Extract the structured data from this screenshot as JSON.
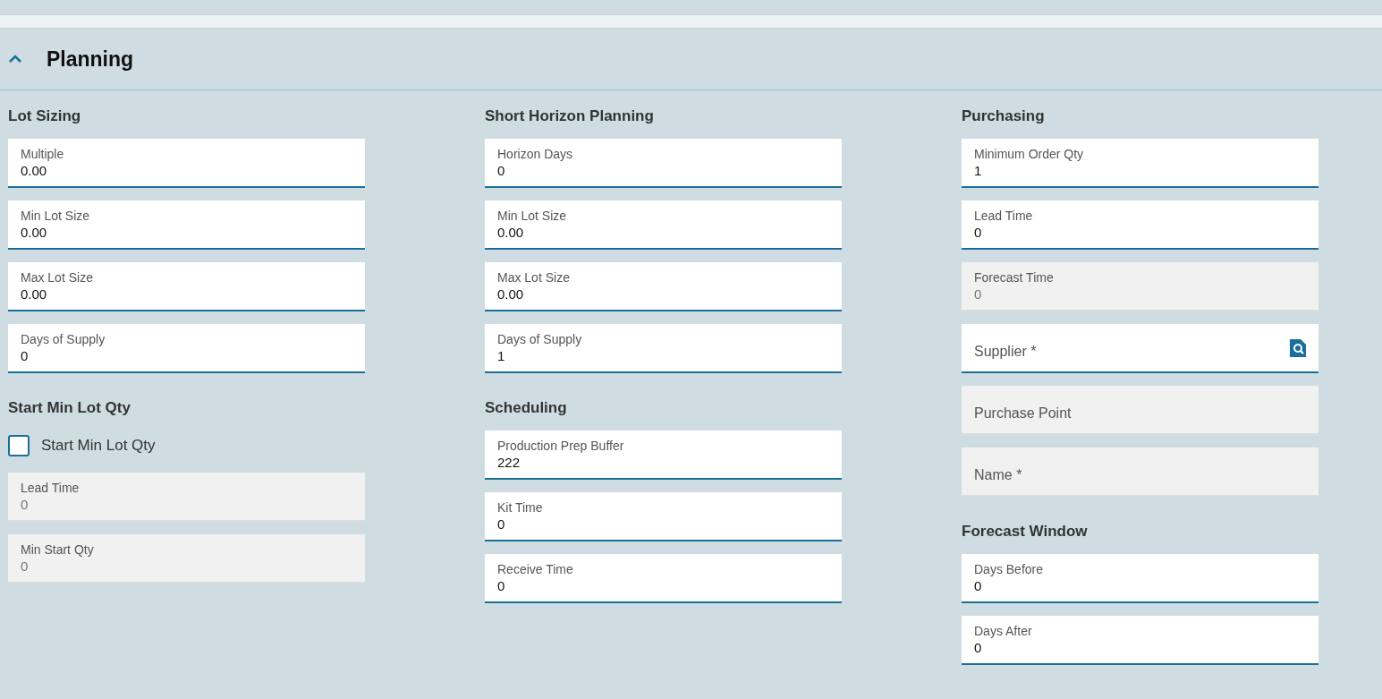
{
  "section": {
    "title": "Planning",
    "expanded": true
  },
  "columns": [
    {
      "items": [
        {
          "kind": "heading",
          "text": "Lot Sizing"
        },
        {
          "kind": "field",
          "label": "Multiple",
          "value": "0.00",
          "disabled": false
        },
        {
          "kind": "field",
          "label": "Min Lot Size",
          "value": "0.00",
          "disabled": false
        },
        {
          "kind": "field",
          "label": "Max Lot Size",
          "value": "0.00",
          "disabled": false
        },
        {
          "kind": "field",
          "label": "Days of Supply",
          "value": "0",
          "disabled": false
        },
        {
          "kind": "heading",
          "text": "Start Min Lot Qty"
        },
        {
          "kind": "checkbox",
          "label": "Start Min Lot Qty",
          "checked": false
        },
        {
          "kind": "field",
          "label": "Lead Time",
          "value": "0",
          "disabled": true
        },
        {
          "kind": "field",
          "label": "Min Start Qty",
          "value": "0",
          "disabled": true
        }
      ]
    },
    {
      "items": [
        {
          "kind": "heading",
          "text": "Short Horizon Planning"
        },
        {
          "kind": "field",
          "label": "Horizon Days",
          "value": "0",
          "disabled": false
        },
        {
          "kind": "field",
          "label": "Min Lot Size",
          "value": "0.00",
          "disabled": false
        },
        {
          "kind": "field",
          "label": "Max Lot Size",
          "value": "0.00",
          "disabled": false
        },
        {
          "kind": "field",
          "label": "Days of Supply",
          "value": "1",
          "disabled": false
        },
        {
          "kind": "heading",
          "text": "Scheduling"
        },
        {
          "kind": "field",
          "label": "Production Prep Buffer",
          "value": "222",
          "disabled": false
        },
        {
          "kind": "field",
          "label": "Kit Time",
          "value": "0",
          "disabled": false
        },
        {
          "kind": "field",
          "label": "Receive Time",
          "value": "0",
          "disabled": false
        }
      ]
    },
    {
      "items": [
        {
          "kind": "heading",
          "text": "Purchasing"
        },
        {
          "kind": "field",
          "label": "Minimum Order Qty",
          "value": "1",
          "disabled": false
        },
        {
          "kind": "field",
          "label": "Lead Time",
          "value": "0",
          "disabled": false
        },
        {
          "kind": "field",
          "label": "Forecast Time",
          "value": "0",
          "disabled": true
        },
        {
          "kind": "lookup",
          "label": "Supplier *",
          "disabled": false
        },
        {
          "kind": "field",
          "label": "Purchase Point",
          "disabled": true
        },
        {
          "kind": "field",
          "label": "Name *",
          "disabled": true
        },
        {
          "kind": "heading",
          "text": "Forecast Window"
        },
        {
          "kind": "field",
          "label": "Days Before",
          "value": "0",
          "disabled": false
        },
        {
          "kind": "field",
          "label": "Days After",
          "value": "0",
          "disabled": false
        }
      ]
    }
  ]
}
